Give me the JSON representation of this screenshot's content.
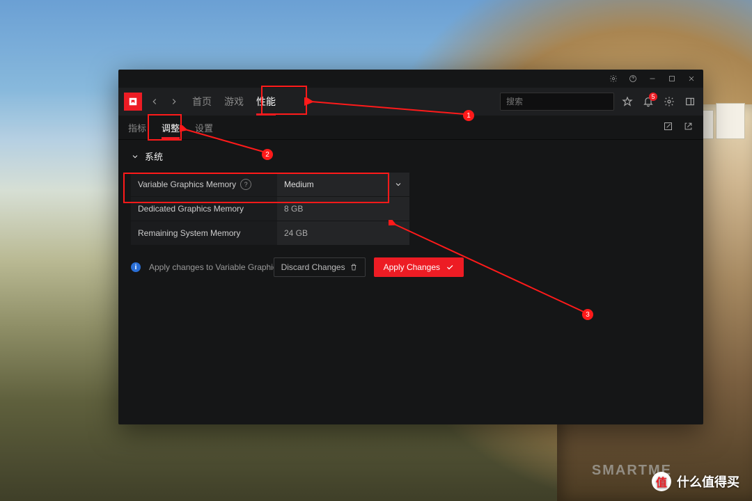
{
  "titlebar": {
    "minimize": "_",
    "maximize": "□",
    "close": "×"
  },
  "toolbar": {
    "tabs": [
      "首页",
      "游戏",
      "性能"
    ],
    "active_tab": "性能",
    "search_placeholder": "搜索",
    "bell_badge": "5"
  },
  "subtabs": {
    "items": [
      "指标",
      "调整",
      "设置"
    ],
    "active": "调整"
  },
  "section": {
    "title": "系统"
  },
  "rows": [
    {
      "label": "Variable Graphics Memory",
      "value": "Medium",
      "help": true,
      "dropdown": true
    },
    {
      "label": "Dedicated Graphics Memory",
      "value": "8 GB"
    },
    {
      "label": "Remaining System Memory",
      "value": "24 GB"
    }
  ],
  "footer": {
    "info": "Apply changes to Variable Graphics Memory",
    "discard": "Discard Changes",
    "apply": "Apply Changes"
  },
  "annotations": {
    "n1": "1",
    "n2": "2",
    "n3": "3"
  },
  "watermark": {
    "text": "什么值得买",
    "faint": "SMARTME"
  }
}
